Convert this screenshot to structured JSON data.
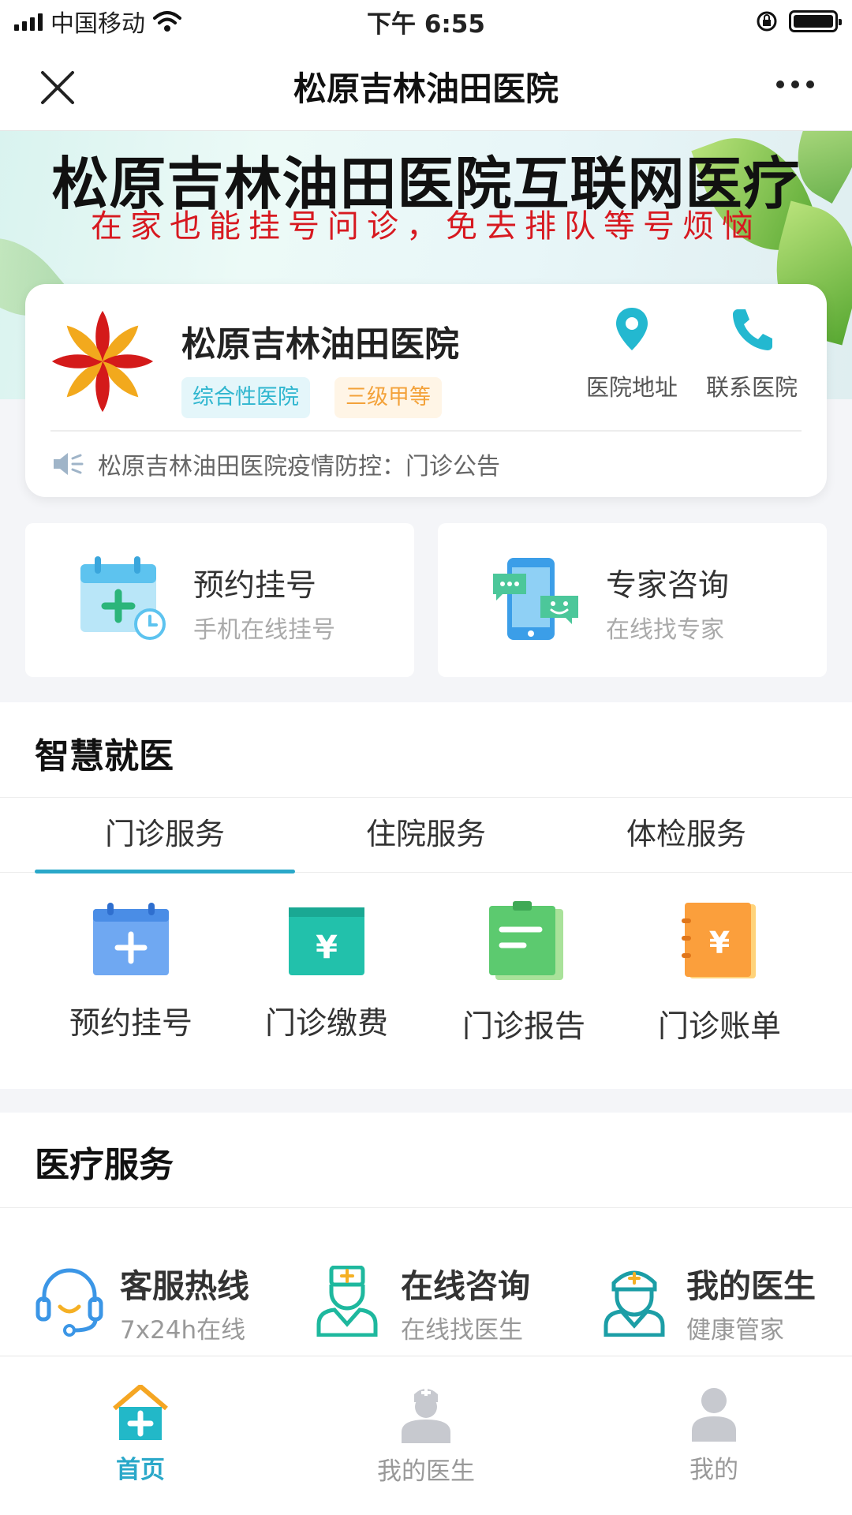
{
  "status_bar": {
    "carrier": "中国移动",
    "time": "下午 6:55"
  },
  "nav": {
    "title": "松原吉林油田医院"
  },
  "banner": {
    "title": "松原吉林油田医院互联网医疗",
    "subtitle": "在家也能挂号问诊，免去排队等号烦恼"
  },
  "hospital": {
    "name": "松原吉林油田医院",
    "tags": [
      "综合性医院",
      "三级甲等"
    ],
    "actions": {
      "address": "医院地址",
      "contact": "联系医院"
    },
    "notice": "松原吉林油田医院疫情防控：门诊公告"
  },
  "quick_tiles": [
    {
      "title": "预约挂号",
      "subtitle": "手机在线挂号"
    },
    {
      "title": "专家咨询",
      "subtitle": "在线找专家"
    }
  ],
  "smart_medical": {
    "title": "智慧就医",
    "tabs": [
      "门诊服务",
      "住院服务",
      "体检服务"
    ],
    "active_tab": "门诊服务",
    "services": [
      "预约挂号",
      "门诊缴费",
      "门诊报告",
      "门诊账单"
    ]
  },
  "medical_services": {
    "title": "医疗服务",
    "items": [
      {
        "title": "客服热线",
        "subtitle": "7x24h在线"
      },
      {
        "title": "在线咨询",
        "subtitle": "在线找医生"
      },
      {
        "title": "我的医生",
        "subtitle": "健康管家"
      }
    ]
  },
  "tab_bar": {
    "items": [
      "首页",
      "我的医生",
      "我的"
    ],
    "active": "首页"
  },
  "colors": {
    "accent": "#2aa8c9",
    "notice_red": "#d71920",
    "tag_teal": "#2fb6cf",
    "tag_orange": "#f3a23a"
  }
}
